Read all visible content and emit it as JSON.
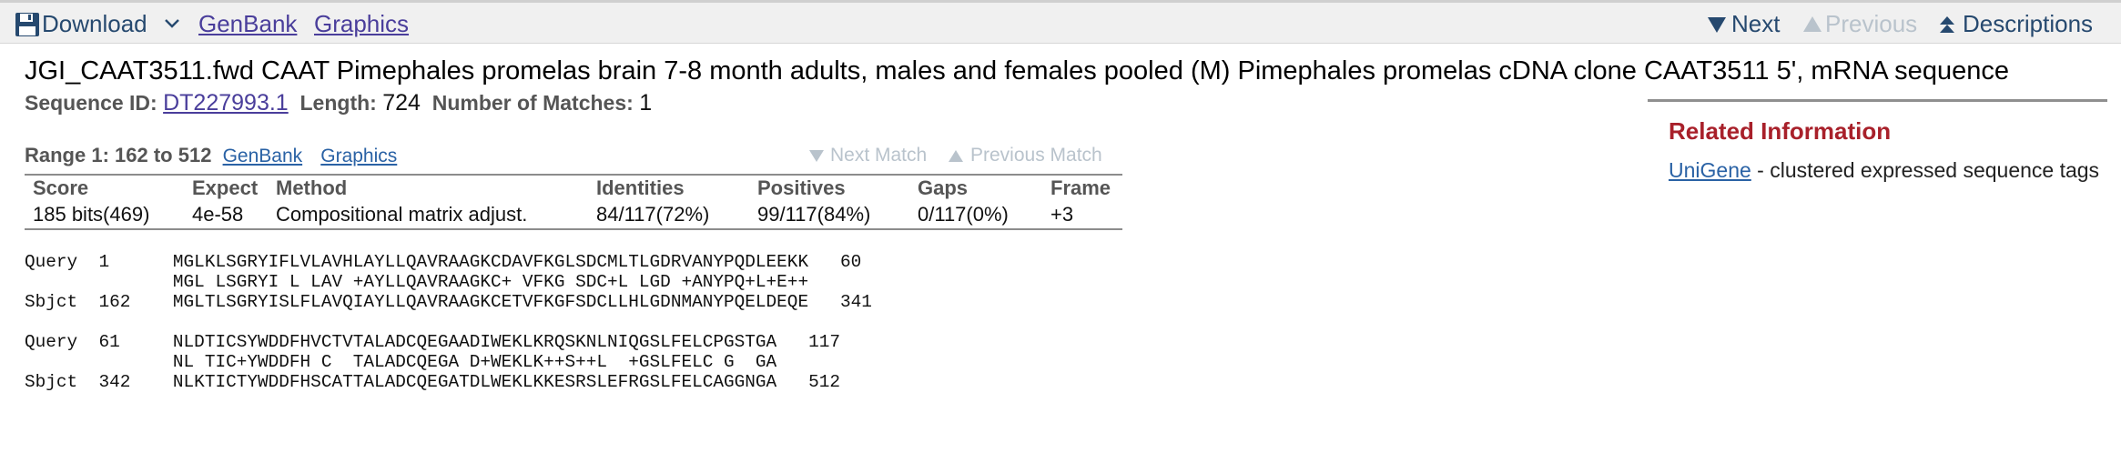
{
  "toolbar": {
    "download_label": "Download",
    "genbank_label": "GenBank",
    "graphics_label": "Graphics",
    "next_label": "Next",
    "previous_label": "Previous",
    "descriptions_label": "Descriptions"
  },
  "hit": {
    "title": "JGI_CAAT3511.fwd CAAT Pimephales promelas brain 7-8 month adults, males and females pooled (M) Pimephales promelas cDNA clone CAAT3511 5', mRNA sequence",
    "sequence_id_label": "Sequence ID:",
    "sequence_id": "DT227993.1",
    "length_label": "Length:",
    "length": "724",
    "matches_label": "Number of Matches:",
    "matches": "1"
  },
  "related": {
    "title": "Related Information",
    "item_link": "UniGene",
    "item_desc": "- clustered expressed sequence tags"
  },
  "range": {
    "label": "Range 1: 162 to 512",
    "genbank_label": "GenBank",
    "graphics_label": "Graphics",
    "next_match_label": "Next Match",
    "previous_match_label": "Previous Match"
  },
  "stats": {
    "headers": [
      "Score",
      "Expect",
      "Method",
      "Identities",
      "Positives",
      "Gaps",
      "Frame"
    ],
    "values": [
      "185 bits(469)",
      "4e-58",
      "Compositional matrix adjust.",
      "84/117(72%)",
      "99/117(84%)",
      "0/117(0%)",
      "+3"
    ]
  },
  "alignment": {
    "block1": "Query  1      MGLKLSGRYIFLVLAVHLAYLLQAVRAAGKCDAVFKGLSDCMLTLGDRVANYPQDLEEKK   60\n              MGL LSGRYI L LAV +AYLLQAVRAAGKC+ VFKG SDC+L LGD +ANYPQ+L+E++\nSbjct  162    MGLTLSGRYISLFLAVQIAYLLQAVRAAGKCETVFKGFSDCLLHLGDNMANYPQELDEQE   341",
    "block2": "Query  61     NLDTICSYWDDFHVCTVTALADCQEGAADIWEKLKRQSKNLNIQGSLFELCPGSTGA   117\n              NL TIC+YWDDFH C  TALADCQEGA D+WEKLK++S++L  +GSLFELC G  GA\nSbjct  342    NLKTICTYWDDFHSCATTALADCQEGATDLWEKLKKESRSLEFRGSLFELCAGGNGA   512"
  },
  "colors": {
    "link": "#4a3e9b",
    "related_title": "#a8202a",
    "disabled": "#b9c3cc"
  }
}
